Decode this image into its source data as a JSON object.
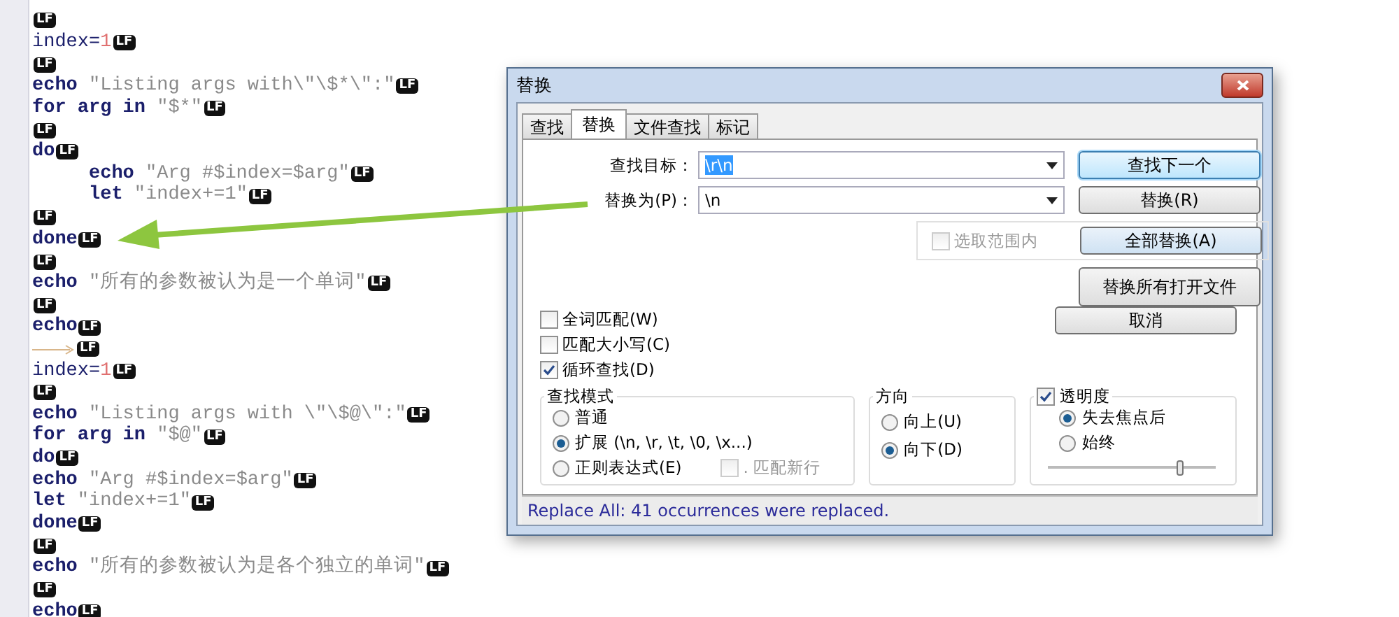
{
  "editor": {
    "lines": [
      {
        "indented": false,
        "tab": false,
        "eol": "LF"
      },
      {
        "indented": false,
        "tab": false,
        "tokens": [
          {
            "kind": "plain",
            "text": "index="
          },
          {
            "kind": "number",
            "text": "1"
          }
        ],
        "eol": "LF"
      },
      {
        "indented": false,
        "tab": false,
        "eol": "LF"
      },
      {
        "indented": false,
        "tab": false,
        "tokens": [
          {
            "kind": "keyword",
            "text": "echo"
          },
          {
            "kind": "string",
            "text": "\"Listing args with\\\"\\$*\\\":\""
          }
        ],
        "eol": "LF"
      },
      {
        "indented": false,
        "tab": false,
        "tokens": [
          {
            "kind": "keyword",
            "text": "for arg in"
          },
          {
            "kind": "string",
            "text": "\"$*\""
          }
        ],
        "eol": "LF"
      },
      {
        "indented": false,
        "tab": false,
        "eol": "LF"
      },
      {
        "indented": false,
        "tab": false,
        "tokens": [
          {
            "kind": "keyword",
            "text": "do"
          }
        ],
        "eol": "LF"
      },
      {
        "indented": true,
        "tab": false,
        "tokens": [
          {
            "kind": "keyword",
            "text": "echo"
          },
          {
            "kind": "string",
            "text": "\"Arg #$index=$arg\""
          }
        ],
        "eol": "LF"
      },
      {
        "indented": true,
        "tab": false,
        "tokens": [
          {
            "kind": "keyword",
            "text": "let"
          },
          {
            "kind": "string",
            "text": "\"index+=1\""
          }
        ],
        "eol": "LF"
      },
      {
        "indented": false,
        "tab": false,
        "eol": "LF"
      },
      {
        "indented": false,
        "tab": false,
        "tokens": [
          {
            "kind": "keyword",
            "text": "done"
          }
        ],
        "eol": "LF"
      },
      {
        "indented": false,
        "tab": false,
        "eol": "LF"
      },
      {
        "indented": false,
        "tab": false,
        "tokens": [
          {
            "kind": "keyword",
            "text": "echo"
          },
          {
            "kind": "string",
            "text": "\"所有的参数被认为是一个单词\""
          }
        ],
        "eol": "LF"
      },
      {
        "indented": false,
        "tab": false,
        "eol": "LF"
      },
      {
        "indented": false,
        "tab": false,
        "tokens": [
          {
            "kind": "keyword",
            "text": "echo"
          }
        ],
        "eol": "LF"
      },
      {
        "indented": false,
        "tab": true,
        "eol": "LF"
      },
      {
        "indented": false,
        "tab": false,
        "tokens": [
          {
            "kind": "plain",
            "text": "index="
          },
          {
            "kind": "number",
            "text": "1"
          }
        ],
        "eol": "LF"
      },
      {
        "indented": false,
        "tab": false,
        "eol": "LF"
      },
      {
        "indented": false,
        "tab": false,
        "tokens": [
          {
            "kind": "keyword",
            "text": "echo"
          },
          {
            "kind": "string",
            "text": "\"Listing args with \\\"\\$@\\\":\""
          }
        ],
        "eol": "LF"
      },
      {
        "indented": false,
        "tab": false,
        "tokens": [
          {
            "kind": "keyword",
            "text": "for arg in"
          },
          {
            "kind": "string",
            "text": "\"$@\""
          }
        ],
        "eol": "LF"
      },
      {
        "indented": false,
        "tab": false,
        "tokens": [
          {
            "kind": "keyword",
            "text": "do"
          }
        ],
        "eol": "LF"
      },
      {
        "indented": false,
        "tab": false,
        "tokens": [
          {
            "kind": "keyword",
            "text": "echo"
          },
          {
            "kind": "string",
            "text": "\"Arg #$index=$arg\""
          }
        ],
        "eol": "LF"
      },
      {
        "indented": false,
        "tab": false,
        "tokens": [
          {
            "kind": "keyword",
            "text": "let"
          },
          {
            "kind": "string",
            "text": "\"index+=1\""
          }
        ],
        "eol": "LF"
      },
      {
        "indented": false,
        "tab": false,
        "tokens": [
          {
            "kind": "keyword",
            "text": "done"
          }
        ],
        "eol": "LF"
      },
      {
        "indented": false,
        "tab": false,
        "eol": "LF"
      },
      {
        "indented": false,
        "tab": false,
        "tokens": [
          {
            "kind": "keyword",
            "text": "echo"
          },
          {
            "kind": "string",
            "text": "\"所有的参数被认为是各个独立的单词\""
          }
        ],
        "eol": "LF"
      },
      {
        "indented": false,
        "tab": false,
        "eol": "LF"
      },
      {
        "indented": false,
        "tab": false,
        "tokens": [
          {
            "kind": "keyword",
            "text": "echo"
          }
        ],
        "eol": "LF"
      }
    ]
  },
  "dialog": {
    "title": "替换",
    "tabs": [
      {
        "label": "查找",
        "selected": false
      },
      {
        "label": "替换",
        "selected": true
      },
      {
        "label": "文件查找",
        "selected": false
      },
      {
        "label": "标记",
        "selected": false
      }
    ],
    "find": {
      "label": "查找目标：",
      "value": "\\r\\n",
      "highlighted": true
    },
    "replace": {
      "label": "替换为(P)：",
      "value": "\\n",
      "highlighted": false
    },
    "in_selection": {
      "label": "选取范围内",
      "checked": false,
      "disabled": true
    },
    "buttons": [
      {
        "label": "查找下一个",
        "default": true
      },
      {
        "label": "替换(R)",
        "default": false
      },
      {
        "label": "全部替换(A)",
        "default": false
      },
      {
        "label": "替换所有打开文件",
        "default": false
      },
      {
        "label": "取消",
        "default": false
      }
    ],
    "options": [
      {
        "label": "全词匹配(W)",
        "checked": false
      },
      {
        "label": "匹配大小写(C)",
        "checked": false
      },
      {
        "label": "循环查找(D)",
        "checked": true
      }
    ],
    "search_mode": {
      "title": "查找模式",
      "modes": [
        {
          "label": "普通",
          "selected": false
        },
        {
          "label": "扩展 (\\n, \\r, \\t, \\0, \\x...)",
          "selected": true
        },
        {
          "label": "正则表达式(E)",
          "selected": false
        }
      ],
      "dot_newline": {
        "label": ". 匹配新行",
        "checked": false,
        "disabled": true
      }
    },
    "direction": {
      "title": "方向",
      "options": [
        {
          "label": "向上(U)",
          "selected": false
        },
        {
          "label": "向下(D)",
          "selected": true
        }
      ]
    },
    "transparency": {
      "label": "透明度",
      "checked": true,
      "options": [
        {
          "label": "失去焦点后",
          "selected": true
        },
        {
          "label": "始终",
          "selected": false
        }
      ],
      "level": 0.78
    },
    "status": "Replace All: 41 occurrences were replaced."
  }
}
